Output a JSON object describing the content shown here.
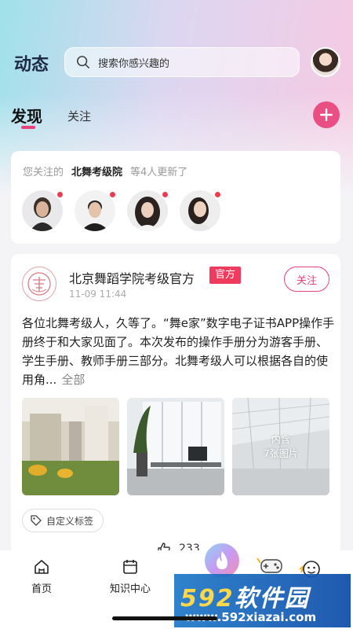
{
  "header": {
    "title": "动态",
    "search_placeholder": "搜索你感兴趣的"
  },
  "tabs": [
    {
      "label": "发现",
      "active": true
    },
    {
      "label": "关注",
      "active": false
    }
  ],
  "follow_update": {
    "prefix": "您关注的",
    "name": "北舞考级院",
    "suffix": "等4人更新了",
    "avatars": [
      "avatar-1",
      "avatar-2",
      "avatar-3",
      "avatar-4"
    ]
  },
  "post": {
    "org_name": "北京舞蹈学院考级官方",
    "badge": "官方",
    "time": "11-09 11:44",
    "follow_label": "关注",
    "body": "各位北舞考级人，久等了。“舞e家”数字电子证书APP操作手册终于和大家见面了。本次发布的操作手册分为游客手册、学生手册、教师手册三部分。北舞考级人可以根据各自的使用角...",
    "more_label": "全部",
    "image_overlay_line1": "内含",
    "image_overlay_line2": "7张图片",
    "tag_label": "自定义标签",
    "likes": "233"
  },
  "tabbar": {
    "home_label": "首页",
    "knowledge_label": "知识中心"
  },
  "watermark": {
    "brand_num": "592",
    "brand_text": "软件园",
    "url": "www.592xiazai.com"
  },
  "colors": {
    "accent": "#e8407a",
    "badge": "#ee3b5e"
  }
}
